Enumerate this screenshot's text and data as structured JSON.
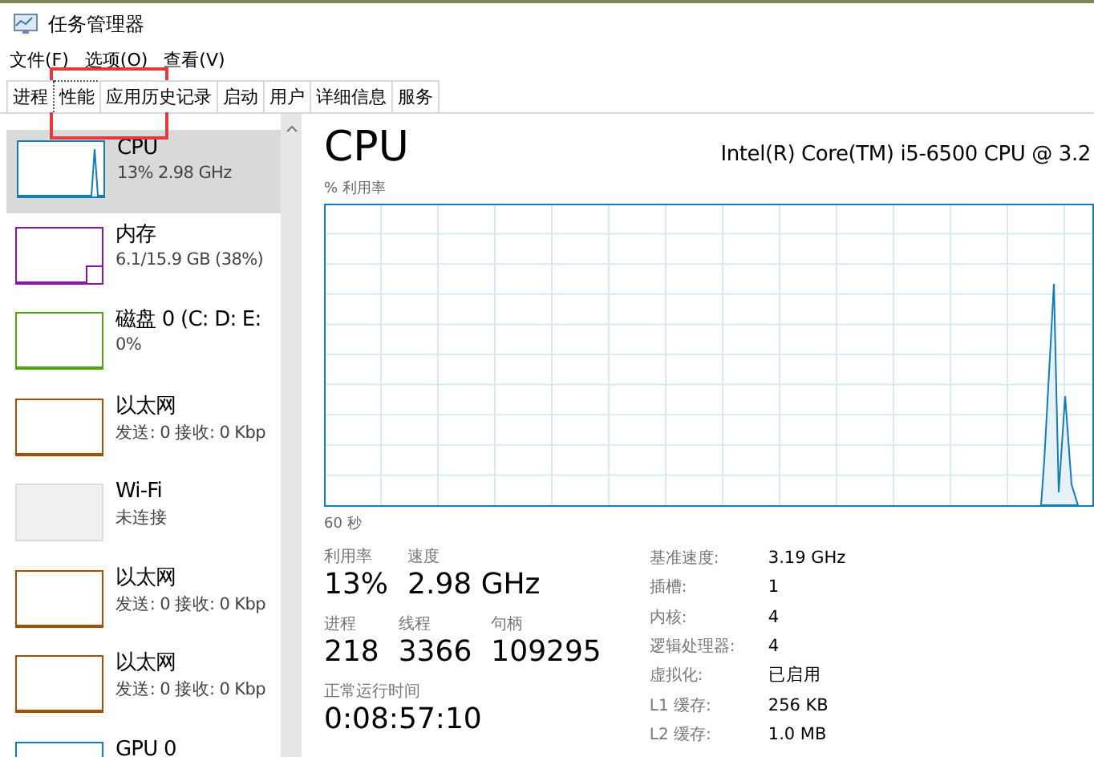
{
  "window": {
    "title": "任务管理器"
  },
  "menu": [
    "文件(F)",
    "选项(O)",
    "查看(V)"
  ],
  "tabs": [
    {
      "label": "进程",
      "selected": false
    },
    {
      "label": "性能",
      "selected": true
    },
    {
      "label": "应用历史记录",
      "selected": false
    },
    {
      "label": "启动",
      "selected": false
    },
    {
      "label": "用户",
      "selected": false
    },
    {
      "label": "详细信息",
      "selected": false
    },
    {
      "label": "服务",
      "selected": false
    }
  ],
  "sidebar": {
    "items": [
      {
        "name": "CPU",
        "detail": "13% 2.98 GHz",
        "color": "#117dbb",
        "selected": true,
        "kind": "spike"
      },
      {
        "name": "内存",
        "detail": "6.1/15.9 GB (38%)",
        "color": "#8b12ae",
        "selected": false,
        "kind": "step"
      },
      {
        "name": "磁盘 0 (C: D: E:",
        "detail": "0%",
        "color": "#4da60c",
        "selected": false,
        "kind": "flat"
      },
      {
        "name": "以太网",
        "detail": "发送: 0 接收: 0 Kbp",
        "color": "#a74f01",
        "selected": false,
        "kind": "flat"
      },
      {
        "name": "Wi-Fi",
        "detail": "未连接",
        "color": "#dcdcdc",
        "selected": false,
        "kind": "off"
      },
      {
        "name": "以太网",
        "detail": "发送: 0 接收: 0 Kbp",
        "color": "#a74f01",
        "selected": false,
        "kind": "flat"
      },
      {
        "name": "以太网",
        "detail": "发送: 0 接收: 0 Kbp",
        "color": "#a74f01",
        "selected": false,
        "kind": "flat"
      },
      {
        "name": "GPU 0",
        "color": "#117dbb",
        "selected": false,
        "kind": "flat"
      }
    ]
  },
  "main": {
    "title": "CPU",
    "model": "Intel(R) Core(TM) i5-6500 CPU @ 3.2",
    "graph_label": "% 利用率",
    "time_label": "60 秒",
    "stats": [
      [
        {
          "label": "利用率",
          "value": "13%"
        },
        {
          "label": "速度",
          "value": "2.98 GHz"
        }
      ],
      [
        {
          "label": "进程",
          "value": "218"
        },
        {
          "label": "线程",
          "value": "3366"
        },
        {
          "label": "句柄",
          "value": "109295"
        }
      ],
      [
        {
          "label": "正常运行时间",
          "value": "0:08:57:10"
        }
      ]
    ],
    "specs": [
      {
        "label": "基准速度:",
        "value": "3.19 GHz"
      },
      {
        "label": "插槽:",
        "value": "1"
      },
      {
        "label": "内核:",
        "value": "4"
      },
      {
        "label": "逻辑处理器:",
        "value": "4"
      },
      {
        "label": "虚拟化:",
        "value": "已启用"
      },
      {
        "label": "L1 缓存:",
        "value": "256 KB"
      },
      {
        "label": "L2 缓存:",
        "value": "1.0 MB"
      }
    ]
  }
}
